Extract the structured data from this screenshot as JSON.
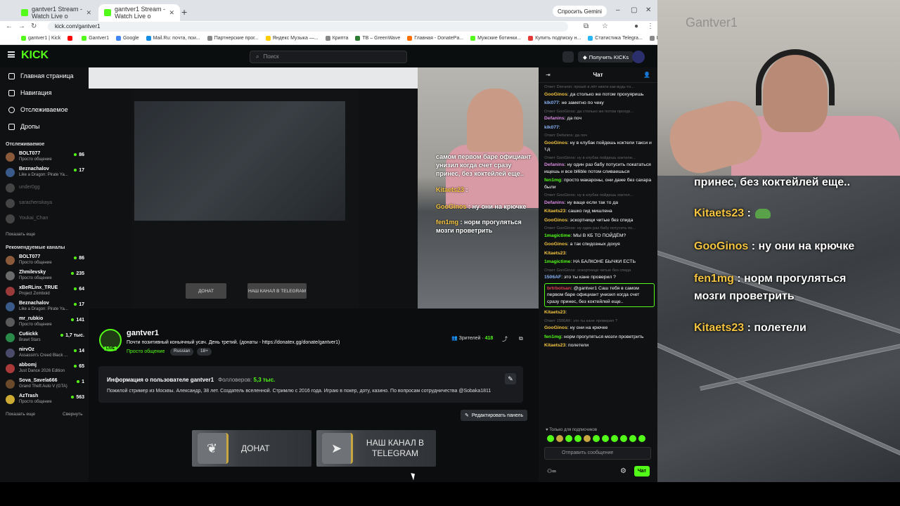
{
  "browser": {
    "tabs": [
      {
        "label": "gantver1 Stream - Watch Live o"
      },
      {
        "label": "gantver1 Stream - Watch Live o"
      }
    ],
    "gemini_label": "Спросить Gemini",
    "url": "kick.com/gantver1",
    "bookmarks": [
      {
        "label": "gantver1 | Kick",
        "color": "#53fc18"
      },
      {
        "label": "",
        "color": "#ff0000"
      },
      {
        "label": "Gantver1",
        "color": "#53fc18"
      },
      {
        "label": "Google",
        "color": "#4285f4"
      },
      {
        "label": "Mail.Ru: почта, пои...",
        "color": "#168de2"
      },
      {
        "label": "Партнерские прог...",
        "color": "#888888"
      },
      {
        "label": "Яндекс Музыка —...",
        "color": "#ffcc00"
      },
      {
        "label": "Крипта",
        "color": "#888888"
      },
      {
        "label": "ТВ – GreenWave",
        "color": "#2e7d32"
      },
      {
        "label": "Главная - DonatePa...",
        "color": "#ff6f00"
      },
      {
        "label": "Мужские ботинки...",
        "color": "#53fc18"
      },
      {
        "label": "Купить подписку н...",
        "color": "#e53935"
      },
      {
        "label": "Статистика Telegra...",
        "color": "#29b6f6"
      },
      {
        "label": "Все закладки",
        "color": "#888888"
      }
    ]
  },
  "header": {
    "logo": "KICK",
    "search_placeholder": "Поиск",
    "get_kicks": "Получить KICKs"
  },
  "sidebar": {
    "nav": [
      {
        "label": "Главная страница"
      },
      {
        "label": "Навигация"
      },
      {
        "label": "Отслеживаемое"
      },
      {
        "label": "Дропы"
      }
    ],
    "following_title": "Отслеживаемое",
    "following": [
      {
        "name": "BOLT077",
        "game": "Просто общение",
        "viewers": "86",
        "color": "#8a5a3a",
        "online": true
      },
      {
        "name": "Beznachalov",
        "game": "Like a Dragon: Pirate Ya...",
        "viewers": "17",
        "color": "#3a5a8a",
        "online": true
      },
      {
        "name": "under0gg",
        "game": "",
        "viewers": "",
        "color": "#444444",
        "online": false
      },
      {
        "name": "sarachenskaya",
        "game": "",
        "viewers": "",
        "color": "#444444",
        "online": false
      },
      {
        "name": "Youkai_Chan",
        "game": "",
        "viewers": "",
        "color": "#444444",
        "online": false
      }
    ],
    "show_more": "Показать еще",
    "recommended_title": "Рекомендуемые каналы",
    "recommended": [
      {
        "name": "BOLT077",
        "game": "Просто общение",
        "viewers": "86",
        "color": "#8a5a3a"
      },
      {
        "name": "Zhmilevsky",
        "game": "Просто общение",
        "viewers": "235",
        "color": "#6a6a6a"
      },
      {
        "name": "xBeRLinx_TRUE",
        "game": "Project Zomboid",
        "viewers": "64",
        "color": "#9a3a3a"
      },
      {
        "name": "Beznachalov",
        "game": "Like a Dragon: Pirate Ya...",
        "viewers": "17",
        "color": "#3a5a8a"
      },
      {
        "name": "mr_rubkio",
        "game": "Просто общение",
        "viewers": "141",
        "color": "#5a5a5a"
      },
      {
        "name": "Cu6ickk",
        "game": "Brawl Stars",
        "viewers": "1,7 тыс.",
        "color": "#2a8a4a"
      },
      {
        "name": "nirvOz",
        "game": "Assassin's Creed Black ...",
        "viewers": "14",
        "color": "#4a4a6a"
      },
      {
        "name": "abbomj",
        "game": "Just Dance 2026 Edition",
        "viewers": "65",
        "color": "#aa3a3a"
      },
      {
        "name": "Sova_Savela666",
        "game": "Grand Theft Auto V (GTA)",
        "viewers": "1",
        "color": "#6a4a2a"
      },
      {
        "name": "AzTrash",
        "game": "Просто общение",
        "viewers": "563",
        "color": "#ccaa33"
      }
    ],
    "show_more2": "Показать еще",
    "collapse": "Свернуть"
  },
  "video": {
    "overlay": [
      {
        "user": "",
        "text": "самом первом баре официант"
      },
      {
        "user": "",
        "text": "унизил когда счет сразу"
      },
      {
        "user": "",
        "text": "принес, без коктейлей еще.."
      },
      {
        "user": "Kitaets23",
        "text": ":"
      },
      {
        "user": "GooGinos",
        "text": ": ну они на крючке"
      },
      {
        "user": "fen1mg",
        "text": ": норм прогуляться"
      },
      {
        "user": "",
        "text": "мозги проветрить"
      }
    ],
    "donate_label": "ДОНАТ",
    "telegram_label": "НАШ КАНАЛ В TELEGRAM"
  },
  "channel": {
    "name": "gantver1",
    "live_badge": "LIVE",
    "title": "Почти позитивный коньячный усач. День третий. (донаты - https://donatex.gg/donate/gantver1)",
    "category": "Просто общение",
    "tags": [
      "Russian",
      "18+"
    ],
    "viewers_label": "Зрителей",
    "viewers_count": "418",
    "about_title": "Информация о пользователе gantver1",
    "followers_label": "Фолловеров:",
    "followers_count": "5,3 тыс.",
    "about_text": "Пожилой стример из Москвы. Александр, 38 лет. Создатель вселенной. Стримлю с 2016 года. Играю в покер, доту, казино. По вопросам сотрудничества @Sobaka1811",
    "edit_panel": "Редактировать панель",
    "panels": [
      {
        "label": "ДОНАТ",
        "icon": "donate-wing-icon"
      },
      {
        "label": "НАШ КАНАЛ В TELEGRAM",
        "icon": "telegram-icon"
      }
    ]
  },
  "chat": {
    "title": "Чат",
    "messages": [
      {
        "reply": "Ответ Dieranin: прошё в лёт квати как-вудь-то...",
        "user": "GooGinos",
        "color": "#f5c542",
        "text": ": да столько же потом прохуяришь"
      },
      {
        "reply": "",
        "user": "klk077",
        "color": "#8ab4f8",
        "text": ": не заметно по чеку"
      },
      {
        "reply": "Ответ GooGinos: да столько же потом прохур...",
        "user": "Defanins",
        "color": "#d98be0",
        "text": ": да поч"
      },
      {
        "reply": "",
        "user": "klk077",
        "color": "#8ab4f8",
        "text": ":"
      },
      {
        "reply": "Ответ Defanins: да поч",
        "user": "GooGinos",
        "color": "#f5c542",
        "text": ": ну в клубак пойдешь коктели такси и т.д"
      },
      {
        "reply": "Ответ GooGinos: ну в клубак пойдешь коктели...",
        "user": "Defanins",
        "color": "#d98be0",
        "text": ": ну один раз бабу потусить покататься ищешь и все bl6ble потом сливаешься"
      },
      {
        "reply": "",
        "user": "fen1mg",
        "color": "#53fc18",
        "text": ": просто макароны, они даже без сахара были"
      },
      {
        "reply": "Ответ GooGinos: ну в клубак пойдешь коктел...",
        "user": "Defanins",
        "color": "#d98be0",
        "text": ": ну ваще если так то да"
      },
      {
        "reply": "",
        "user": "Kitaets23",
        "color": "#f5c542",
        "text": ": сашко гид мишлена"
      },
      {
        "reply": "",
        "user": "GooGinos",
        "color": "#f5c542",
        "text": ": эскортници читые без спида"
      },
      {
        "reply": "Ответ GooGinos: ну один раз бабу потусить по...",
        "user": "1magictime",
        "color": "#53fc18",
        "text": ": МЫ В КБ ТО ПОЙДЁМ?"
      },
      {
        "reply": "",
        "user": "GooGinos",
        "color": "#f5c542",
        "text": ": а так спидозных дохуя"
      },
      {
        "reply": "",
        "user": "Kitaets23",
        "color": "#f5c542",
        "text": ":"
      },
      {
        "reply": "",
        "user": "1magictime",
        "color": "#53fc18",
        "text": ": НА БАЛКОНЕ БЫЧКИ ЕСТЬ"
      },
      {
        "reply": "Ответ GooGinos: эскортници читые без спида",
        "user": "1506AF",
        "color": "#8ab4f8",
        "text": ": это ты кане проверил ?"
      },
      {
        "reply": "",
        "user": "brtrbotsan",
        "color": "#e04050",
        "text": ": @gantver1 Саш тебя в самом первом баре официант унизил когда счет сразу принес, без коктейлей еще..",
        "highlight": true
      },
      {
        "reply": "",
        "user": "Kitaets23",
        "color": "#f5c542",
        "text": ":"
      },
      {
        "reply": "Ответ 1506AF: это ты кане проверил ?",
        "user": "GooGinos",
        "color": "#f5c542",
        "text": ": ну они на крючке"
      },
      {
        "reply": "",
        "user": "fen1mg",
        "color": "#53fc18",
        "text": ": норм прогуляться мозги проветрить"
      },
      {
        "reply": "",
        "user": "Kitaets23",
        "color": "#f5c542",
        "text": ": полетели"
      }
    ],
    "subs_only": "Только для подписчиков",
    "input_placeholder": "Отправить сообщение",
    "send_label": "Чат"
  },
  "stream_overlay": {
    "lines": [
      {
        "user": "",
        "text": "принес, без коктейлей еще.."
      },
      {
        "user": "Kitaets23",
        "text": ":"
      },
      {
        "user": "GooGinos",
        "text": ": ну они на крючке"
      },
      {
        "user": "fen1mg",
        "text": ": норм прогуляться"
      },
      {
        "user": "",
        "text": "мозги проветрить"
      },
      {
        "user": "Kitaets23",
        "text": ": полетели"
      }
    ],
    "watermark": "Gantver1"
  }
}
